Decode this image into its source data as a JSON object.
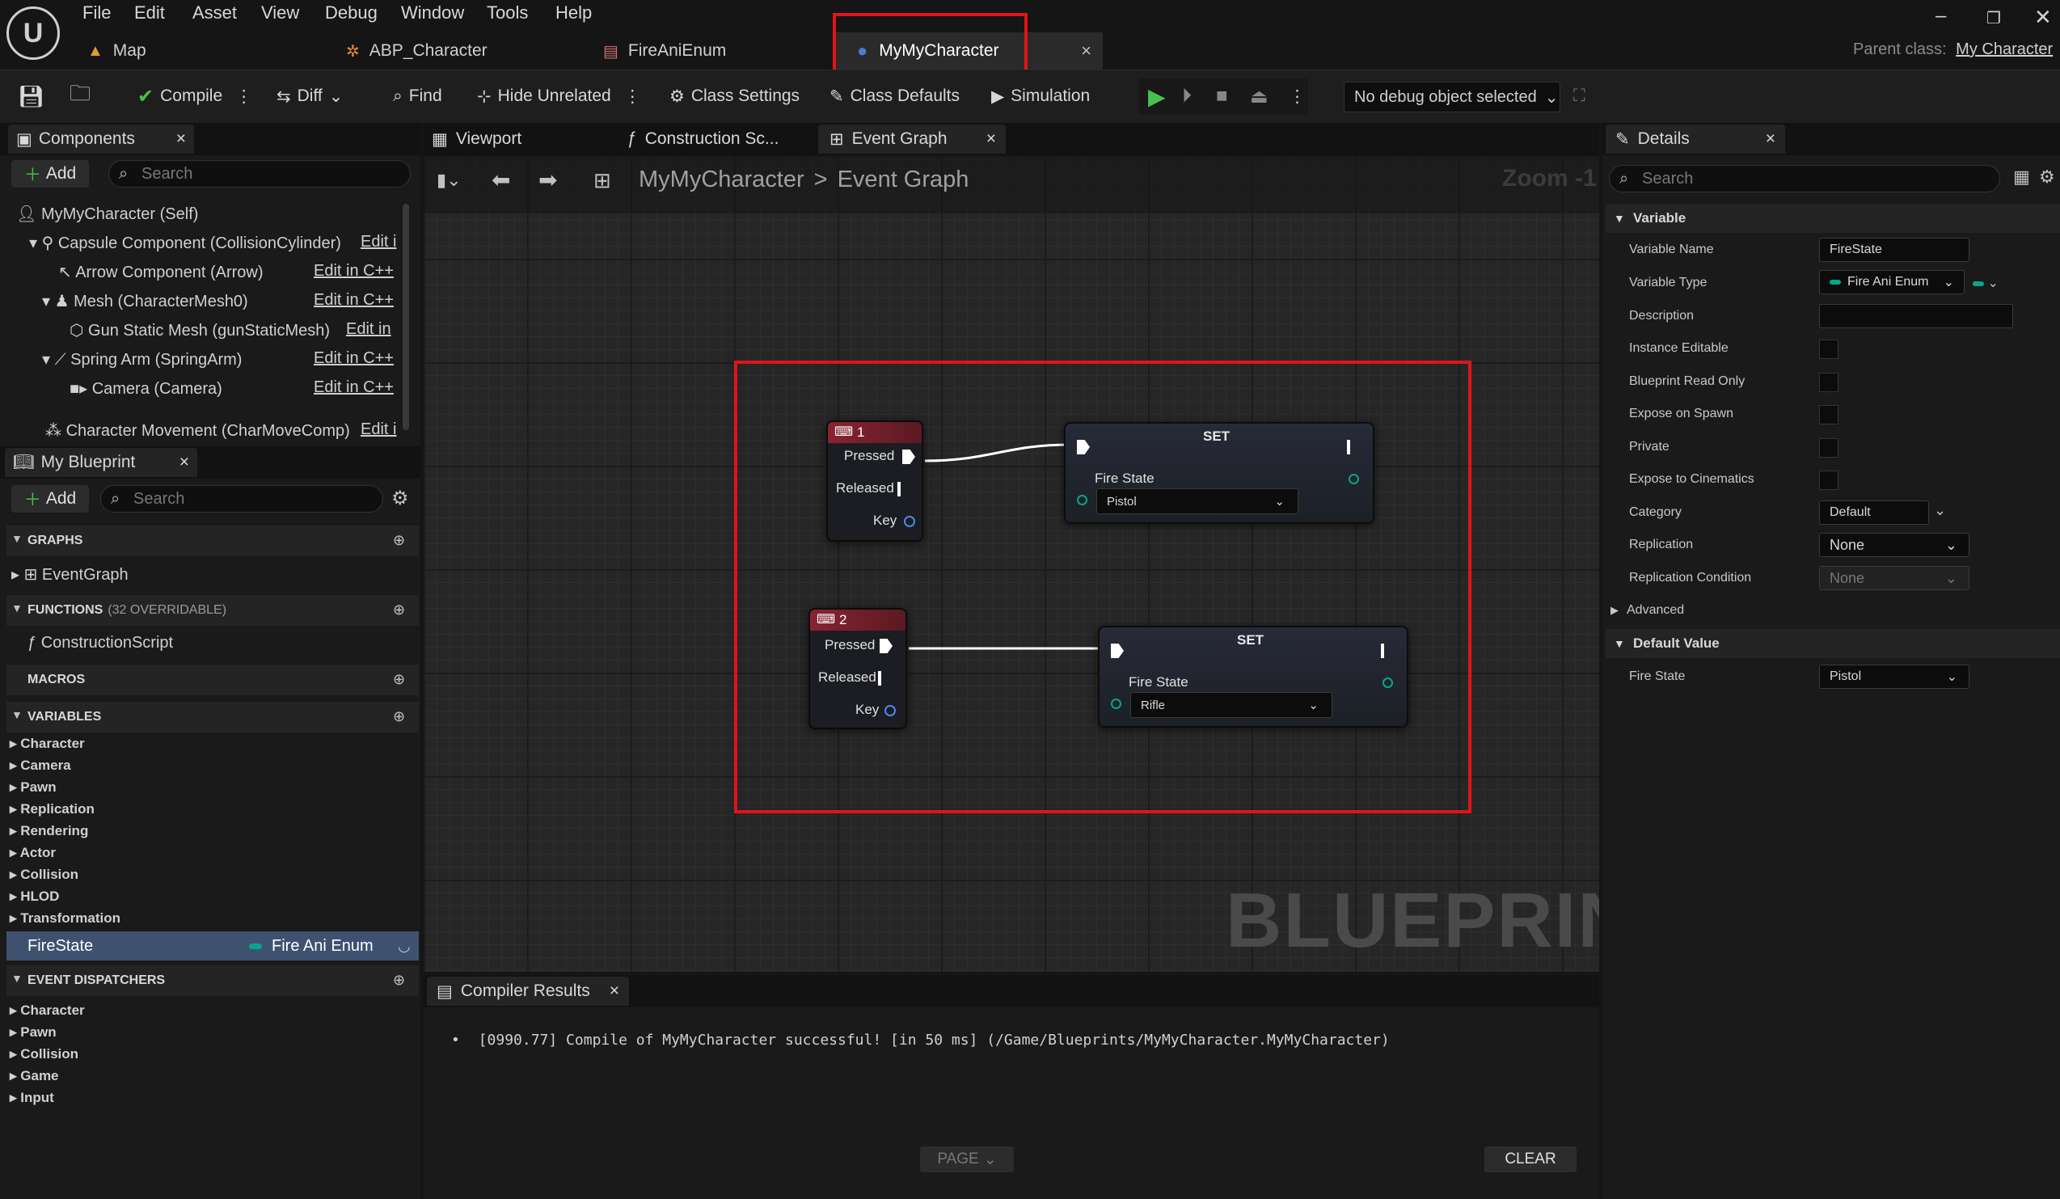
{
  "menu": [
    "File",
    "Edit",
    "Asset",
    "View",
    "Debug",
    "Window",
    "Tools",
    "Help"
  ],
  "tabs": [
    {
      "label": "Map"
    },
    {
      "label": "ABP_Character"
    },
    {
      "label": "FireAniEnum"
    },
    {
      "label": "MyMyCharacter",
      "close": "×"
    }
  ],
  "parent_class": {
    "label": "Parent class:",
    "value": "My Character"
  },
  "toolbar": {
    "compile": "Compile",
    "diff": "Diff",
    "find": "Find",
    "hide_unrelated": "Hide Unrelated",
    "class_settings": "Class Settings",
    "class_defaults": "Class Defaults",
    "simulation": "Simulation",
    "debug_object": "No debug object selected"
  },
  "components": {
    "title": "Components",
    "add": "Add",
    "search_placeholder": "Search",
    "items": [
      {
        "label": "MyMyCharacter (Self)",
        "edit": ""
      },
      {
        "label": "Capsule Component (CollisionCylinder)",
        "edit": "Edit i"
      },
      {
        "label": "Arrow Component (Arrow)",
        "edit": "Edit in C++"
      },
      {
        "label": "Mesh (CharacterMesh0)",
        "edit": "Edit in C++"
      },
      {
        "label": "Gun Static Mesh (gunStaticMesh)",
        "edit": "Edit in"
      },
      {
        "label": "Spring Arm (SpringArm)",
        "edit": "Edit in C++"
      },
      {
        "label": "Camera (Camera)",
        "edit": "Edit in C++"
      },
      {
        "label": "Character Movement (CharMoveComp)",
        "edit": "Edit i"
      }
    ]
  },
  "my_blueprint": {
    "title": "My Blueprint",
    "add": "Add",
    "search_placeholder": "Search",
    "graphs_label": "GRAPHS",
    "event_graph": "EventGraph",
    "functions_label": "FUNCTIONS",
    "functions_count": "(32 OVERRIDABLE)",
    "construction_script": "ConstructionScript",
    "macros_label": "MACROS",
    "variables_label": "VARIABLES",
    "variable_categories": [
      "Character",
      "Camera",
      "Pawn",
      "Replication",
      "Rendering",
      "Actor",
      "Collision",
      "HLOD",
      "Transformation"
    ],
    "selected_variable": {
      "name": "FireState",
      "type": "Fire Ani Enum"
    },
    "dispatchers_label": "EVENT DISPATCHERS",
    "dispatcher_categories": [
      "Character",
      "Pawn",
      "Collision",
      "Game",
      "Input"
    ]
  },
  "graph_tabs": [
    {
      "label": "Viewport"
    },
    {
      "label": "Construction Sc..."
    },
    {
      "label": "Event Graph",
      "close": "×"
    }
  ],
  "graph": {
    "breadcrumb_root": "MyMyCharacter",
    "breadcrumb_sep": ">",
    "breadcrumb_leaf": "Event Graph",
    "zoom": "Zoom -1",
    "watermark": "BLUEPRINT",
    "nodes": [
      {
        "key": "1",
        "pressed": "Pressed",
        "released": "Released",
        "key_label": "Key",
        "set_title": "SET",
        "var": "Fire State",
        "value": "Pistol"
      },
      {
        "key": "2",
        "pressed": "Pressed",
        "released": "Released",
        "key_label": "Key",
        "set_title": "SET",
        "var": "Fire State",
        "value": "Rifle"
      }
    ]
  },
  "compiler": {
    "title": "Compiler Results",
    "close": "×",
    "message": "[0990.77] Compile of MyMyCharacter successful! [in 50 ms] (/Game/Blueprints/MyMyCharacter.MyMyCharacter)",
    "page": "PAGE",
    "clear": "CLEAR"
  },
  "details": {
    "title": "Details",
    "close": "×",
    "search_placeholder": "Search",
    "variable_section": "Variable",
    "variable_name_label": "Variable Name",
    "variable_name": "FireState",
    "variable_type_label": "Variable Type",
    "variable_type": "Fire Ani Enum",
    "description_label": "Description",
    "instance_editable": "Instance Editable",
    "blueprint_read_only": "Blueprint Read Only",
    "expose_on_spawn": "Expose on Spawn",
    "private": "Private",
    "expose_to_cinematics": "Expose to Cinematics",
    "category_label": "Category",
    "category": "Default",
    "replication_label": "Replication",
    "replication": "None",
    "replication_condition_label": "Replication Condition",
    "replication_condition": "None",
    "advanced": "Advanced",
    "default_value_section": "Default Value",
    "fire_state_label": "Fire State",
    "fire_state": "Pistol"
  },
  "colors": {
    "accent_red": "#e0141b",
    "enum_teal": "#0aa48a",
    "node_header_red": "#7a1f2a",
    "selected_row": "#3e5270"
  }
}
